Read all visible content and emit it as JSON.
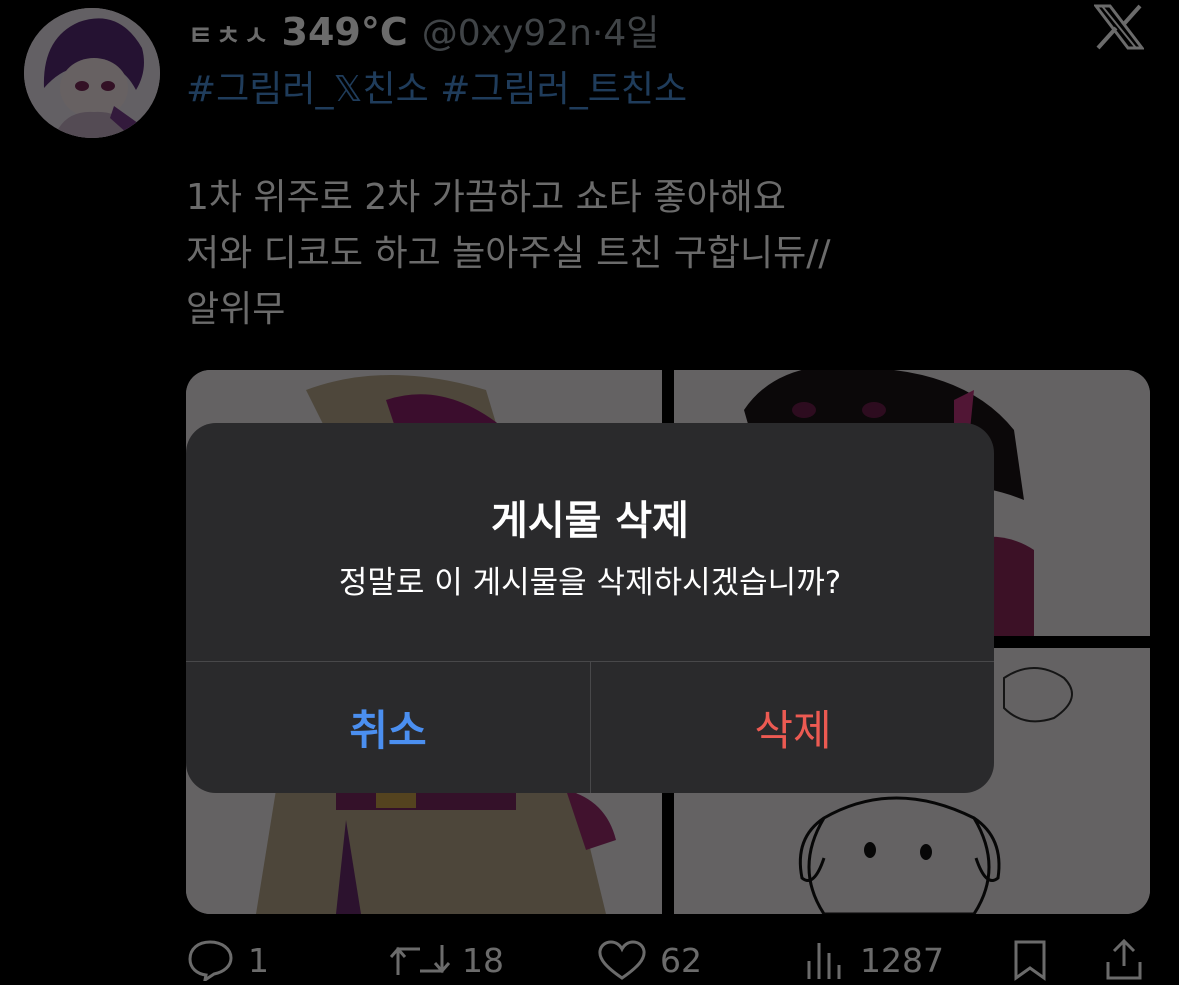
{
  "tweet": {
    "name_prefix": "ㅌㅊㅅ",
    "name_temp": "349°C",
    "handle": "@0xy92n",
    "time_separator": "·",
    "time": "4일",
    "hashtags": "#그림러_𝕏친소 #그림러_트친소",
    "body_lines": [
      "1차 위주로 2차 가끔하고 쇼타 좋아해요",
      "저와 디코도 하고 놀아주실 트친 구합니듀//",
      "알위무"
    ]
  },
  "actions": {
    "replies": "1",
    "reposts": "18",
    "likes": "62",
    "views": "1287"
  },
  "alert": {
    "title": "게시물 삭제",
    "message": "정말로 이 게시물을 삭제하시겠습니까?",
    "cancel_label": "취소",
    "delete_label": "삭제"
  },
  "colors": {
    "background": "#000000",
    "alert_background": "#2a2a2c",
    "cancel": "#4b8ff0",
    "delete": "#ec5a52",
    "hashtag": "#4a8fd8"
  }
}
